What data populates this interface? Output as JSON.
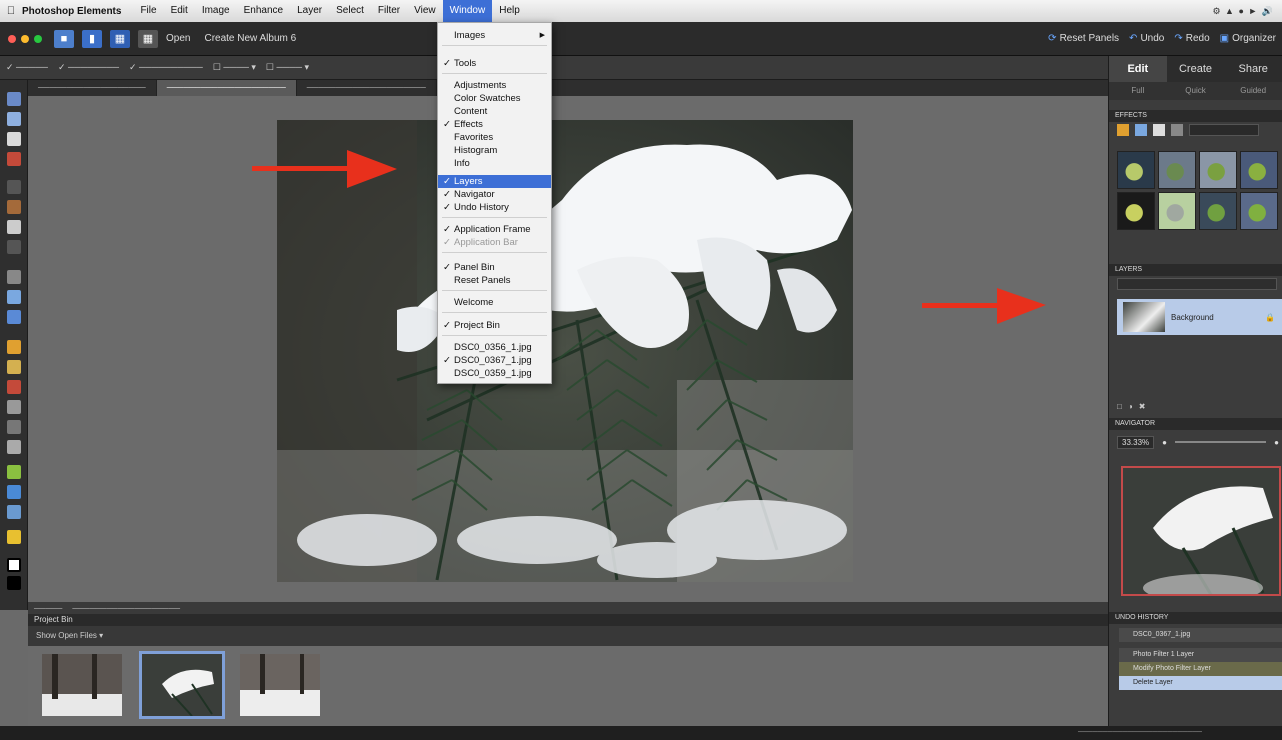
{
  "menubar": {
    "app_name": "Photoshop Elements",
    "items": [
      "File",
      "Edit",
      "Image",
      "Enhance",
      "Layer",
      "Select",
      "Filter",
      "View",
      "Window",
      "Help"
    ],
    "active_item": "Window"
  },
  "topbar": {
    "open_label": "Open",
    "create_label": "Create New Album 6",
    "reset_panels": "Reset Panels",
    "undo": "Undo",
    "redo": "Redo",
    "organizer": "Organizer"
  },
  "window_menu": {
    "items": [
      {
        "label": "Images",
        "checked": false,
        "submenu": true
      },
      {
        "label": "Tools",
        "checked": true
      },
      {
        "label": "Adjustments",
        "checked": false
      },
      {
        "label": "Color Swatches",
        "checked": false
      },
      {
        "label": "Content",
        "checked": false
      },
      {
        "label": "Effects",
        "checked": true
      },
      {
        "label": "Favorites",
        "checked": false
      },
      {
        "label": "Histogram",
        "checked": false
      },
      {
        "label": "Info",
        "checked": false
      },
      {
        "label": "Layers",
        "checked": true,
        "selected": true
      },
      {
        "label": "Navigator",
        "checked": true
      },
      {
        "label": "Undo History",
        "checked": true
      },
      {
        "label": "Application Frame",
        "checked": true
      },
      {
        "label": "Application Bar",
        "checked": true,
        "disabled": true
      },
      {
        "label": "Panel Bin",
        "checked": true
      },
      {
        "label": "Reset Panels",
        "checked": false
      },
      {
        "label": "Welcome",
        "checked": false
      },
      {
        "label": "Project Bin",
        "checked": true
      },
      {
        "label": "DSC0_0356_1.jpg",
        "checked": false
      },
      {
        "label": "DSC0_0367_1.jpg",
        "checked": true
      },
      {
        "label": "DSC0_0359_1.jpg",
        "checked": false
      }
    ]
  },
  "right_panel": {
    "tabs": [
      "Edit",
      "Create",
      "Share"
    ],
    "subtabs": [
      "Full",
      "Quick",
      "Guided"
    ],
    "effects_header": "EFFECTS",
    "layers_header": "LAYERS",
    "layer_name": "Background",
    "navigator_header": "NAVIGATOR",
    "zoom": "33.33%",
    "undo_header": "UNDO HISTORY",
    "history": [
      "DSC0_0367_1.jpg",
      "Photo Filter 1 Layer",
      "Modify Photo Filter Layer",
      "Delete Layer"
    ]
  },
  "project_bin": {
    "header": "Project Bin",
    "show": "Show Open Files"
  },
  "colors": {
    "accent": "#3d6fd6",
    "arrow": "#e8301c"
  }
}
